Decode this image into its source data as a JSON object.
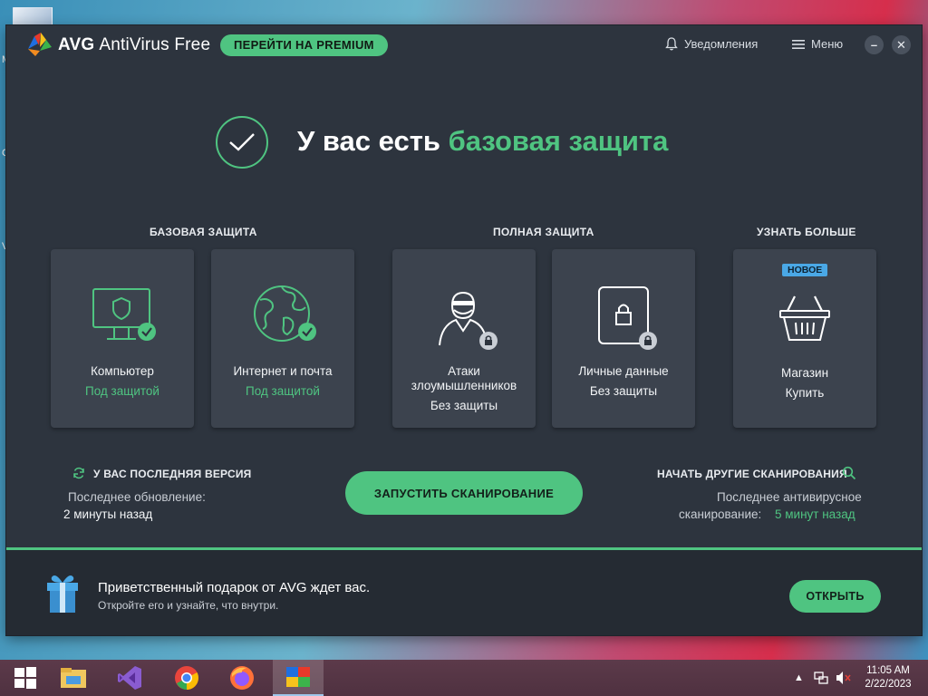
{
  "app": {
    "brand": "AVG",
    "product": "AntiVirus Free",
    "premium_button": "ПЕРЕЙТИ НА PREMIUM",
    "notifications": "Уведомления",
    "menu": "Меню",
    "minimize": "–",
    "close": "✕"
  },
  "hero": {
    "text_plain": "У вас есть",
    "text_accent": "базовая защита"
  },
  "sections": {
    "basic": "БАЗОВАЯ ЗАЩИТА",
    "full": "ПОЛНАЯ ЗАЩИТА",
    "more": "УЗНАТЬ БОЛЬШЕ"
  },
  "tiles": [
    {
      "name": "Компьютер",
      "status": "Под защитой",
      "icon": "monitor-shield-icon"
    },
    {
      "name": "Интернет и почта",
      "status": "Под защитой",
      "icon": "globe-icon"
    },
    {
      "name": "Атаки злоумышленников",
      "status": "Без защиты",
      "icon": "hacker-icon"
    },
    {
      "name": "Личные данные",
      "status": "Без защиты",
      "icon": "lock-document-icon"
    },
    {
      "name": "Магазин",
      "status": "Купить",
      "badge": "НОВОЕ",
      "icon": "basket-icon"
    }
  ],
  "update": {
    "title": "У ВАС ПОСЛЕДНЯЯ ВЕРСИЯ",
    "label": "Последнее обновление:",
    "value": "2 минуты назад"
  },
  "scan": {
    "button": "ЗАПУСТИТЬ СКАНИРОВАНИЕ"
  },
  "other_scans": {
    "title": "НАЧАТЬ ДРУГИЕ СКАНИРОВАНИЯ",
    "label_line1": "Последнее антивирусное",
    "label_line2": "сканирование:",
    "value": "5 минут назад"
  },
  "footer": {
    "title": "Приветственный подарок от AVG ждет вас.",
    "subtitle": "Откройте его и узнайте, что внутри.",
    "button": "ОТКРЫТЬ"
  },
  "taskbar": {
    "apps": [
      "windows-start-icon",
      "file-explorer-icon",
      "visual-studio-icon",
      "chrome-icon",
      "firefox-icon",
      "avg-taskbar-icon"
    ],
    "time": "11:05 AM",
    "date": "2/22/2023"
  },
  "desktop": {
    "letters": [
      "M",
      "C",
      "V"
    ]
  },
  "colors": {
    "accent": "#4fc481",
    "window_bg": "#2d343e",
    "tile_bg": "#3c434e",
    "badge": "#4aa8e6"
  }
}
